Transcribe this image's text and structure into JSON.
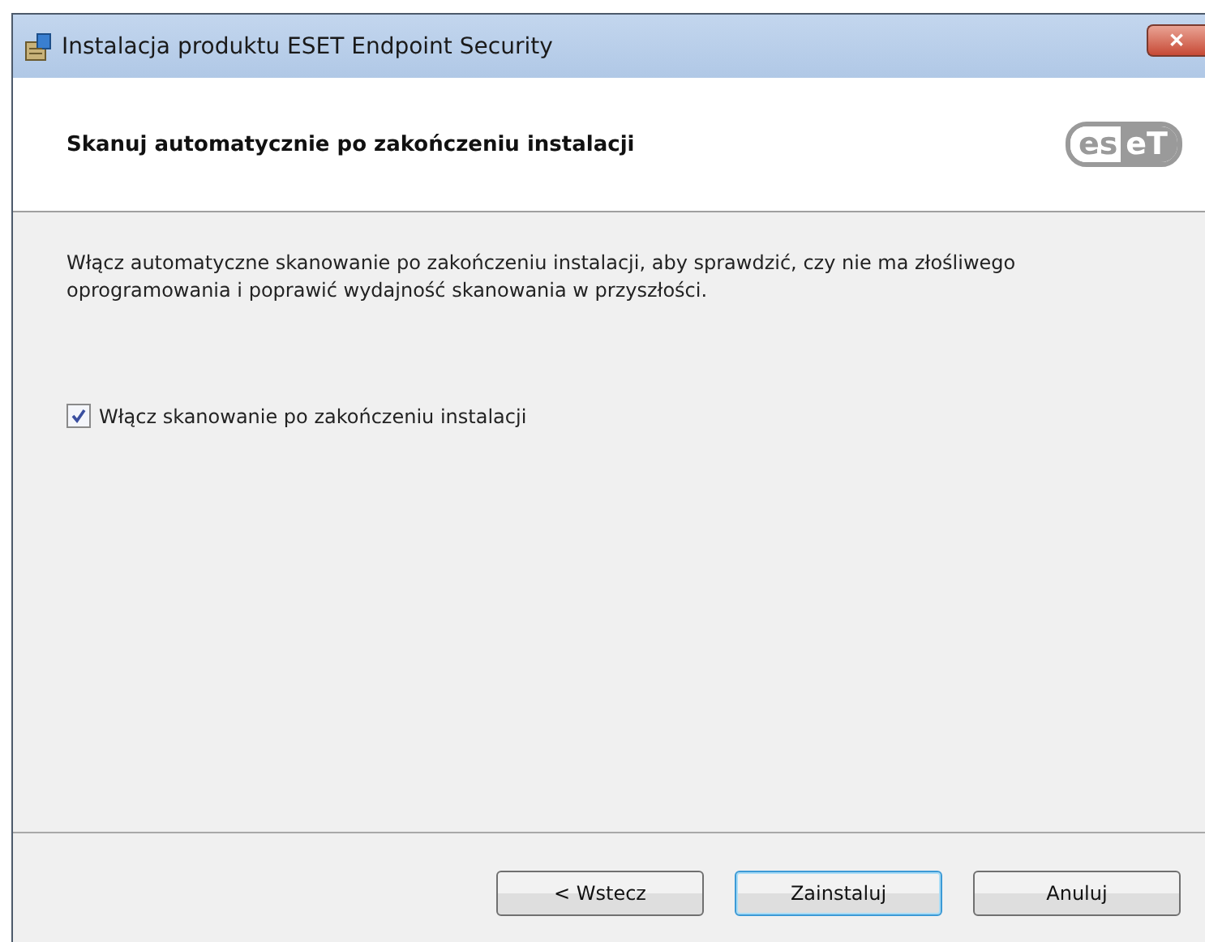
{
  "window": {
    "title": "Instalacja produktu ESET Endpoint Security",
    "close": "✕"
  },
  "header": {
    "title": "Skanuj automatycznie po zakończeniu instalacji",
    "logo_left": "es",
    "logo_right": "eT"
  },
  "body": {
    "description": "Włącz automatyczne skanowanie po zakończeniu instalacji, aby sprawdzić, czy nie ma złośliwego oprogramowania i poprawić wydajność skanowania w przyszłości.",
    "checkbox": {
      "label": "Włącz skanowanie po zakończeniu instalacji",
      "checked": true
    }
  },
  "buttons": [
    {
      "label": "< Wstecz",
      "default": false
    },
    {
      "label": "Zainstaluj",
      "default": true
    },
    {
      "label": "Anuluj",
      "default": false
    }
  ]
}
